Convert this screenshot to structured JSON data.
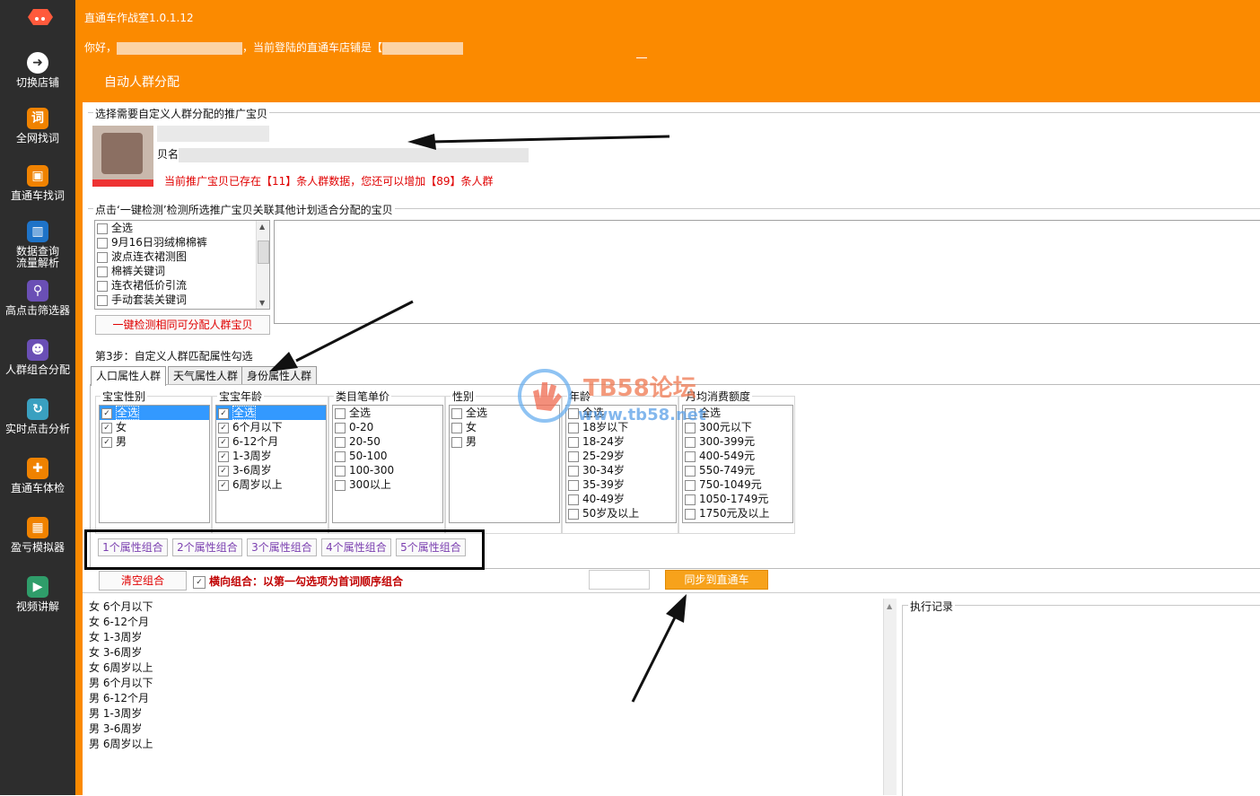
{
  "sidebar": {
    "items": [
      {
        "label": "切换店铺",
        "icon": "arrow-right-circle-icon",
        "glyph": "➜"
      },
      {
        "label": "全网找词",
        "icon": "ci-word-icon",
        "glyph": "词"
      },
      {
        "label": "直通车找词",
        "icon": "train-icon",
        "glyph": "▣"
      },
      {
        "label": "数据查询\n流量解析",
        "icon": "bar-chart-icon",
        "glyph": "▥"
      },
      {
        "label": "高点击筛选器",
        "icon": "map-pin-icon",
        "glyph": "⚲"
      },
      {
        "label": "人群组合分配",
        "icon": "users-icon",
        "glyph": "☻"
      },
      {
        "label": "实时点击分析",
        "icon": "refresh-icon",
        "glyph": "↻"
      },
      {
        "label": "直通车体检",
        "icon": "medical-kit-icon",
        "glyph": "✚"
      },
      {
        "label": "盈亏模拟器",
        "icon": "calculator-icon",
        "glyph": "▦"
      },
      {
        "label": "视频讲解",
        "icon": "video-icon",
        "glyph": "▶"
      }
    ]
  },
  "header": {
    "title": "直通车作战室1.0.1.12",
    "greeting_prefix": "你好，",
    "greeting_mid": "，当前登陆的直通车店铺是【",
    "section_title": "自动人群分配"
  },
  "step1": {
    "title": "选择需要自定义人群分配的推广宝贝",
    "item_label_prefix": "贝名",
    "notice": "当前推广宝贝已存在【11】条人群数据，您还可以增加【89】条人群"
  },
  "step2": {
    "title": "点击‘一键检测’检测所选推广宝贝关联其他计划适合分配的宝贝",
    "list": [
      "全选",
      "9月16日羽绒棉棉裤",
      "波点连衣裙测图",
      "棉裤关键词",
      "连衣裙低价引流",
      "手动套装关键词"
    ],
    "detect_button": "一键检测相同可分配人群宝贝"
  },
  "step3": {
    "title": "第3步：自定义人群匹配属性勾选",
    "tabs": [
      "人口属性人群",
      "天气属性人群",
      "身份属性人群"
    ],
    "groups": [
      {
        "title": "宝宝性别",
        "options": [
          "全选",
          "女",
          "男"
        ],
        "checked": [
          true,
          true,
          true
        ]
      },
      {
        "title": "宝宝年龄",
        "options": [
          "全选",
          "6个月以下",
          "6-12个月",
          "1-3周岁",
          "3-6周岁",
          "6周岁以上"
        ],
        "checked": [
          true,
          true,
          true,
          true,
          true,
          true
        ]
      },
      {
        "title": "类目笔单价",
        "options": [
          "全选",
          "0-20",
          "20-50",
          "50-100",
          "100-300",
          "300以上"
        ],
        "checked": [
          false,
          false,
          false,
          false,
          false,
          false
        ]
      },
      {
        "title": "性别",
        "options": [
          "全选",
          "女",
          "男"
        ],
        "checked": [
          false,
          false,
          false
        ]
      },
      {
        "title": "年龄",
        "options": [
          "全选",
          "18岁以下",
          "18-24岁",
          "25-29岁",
          "30-34岁",
          "35-39岁",
          "40-49岁",
          "50岁及以上"
        ],
        "checked": [
          false,
          false,
          false,
          false,
          false,
          false,
          false,
          false
        ]
      },
      {
        "title": "月均消费额度",
        "options": [
          "全选",
          "300元以下",
          "300-399元",
          "400-549元",
          "550-749元",
          "750-1049元",
          "1050-1749元",
          "1750元及以上"
        ],
        "checked": [
          false,
          false,
          false,
          false,
          false,
          false,
          false,
          false
        ]
      }
    ],
    "combo_buttons": [
      "1个属性组合",
      "2个属性组合",
      "3个属性组合",
      "4个属性组合",
      "5个属性组合"
    ]
  },
  "actions": {
    "clear_button": "清空组合",
    "horizontal_label": "横向组合：以第一勾选项为首词顺序组合",
    "horizontal_checked": true,
    "sync_button": "同步到直通车"
  },
  "results": {
    "lines": [
      "女 6个月以下",
      "女 6-12个月",
      "女 1-3周岁",
      "女 3-6周岁",
      "女 6周岁以上",
      "男 6个月以下",
      "男 6-12个月",
      "男 1-3周岁",
      "男 3-6周岁",
      "男 6周岁以上"
    ]
  },
  "log": {
    "title": "执行记录"
  },
  "watermark": {
    "text": "TB58论坛",
    "url": "www.tb58.net"
  }
}
